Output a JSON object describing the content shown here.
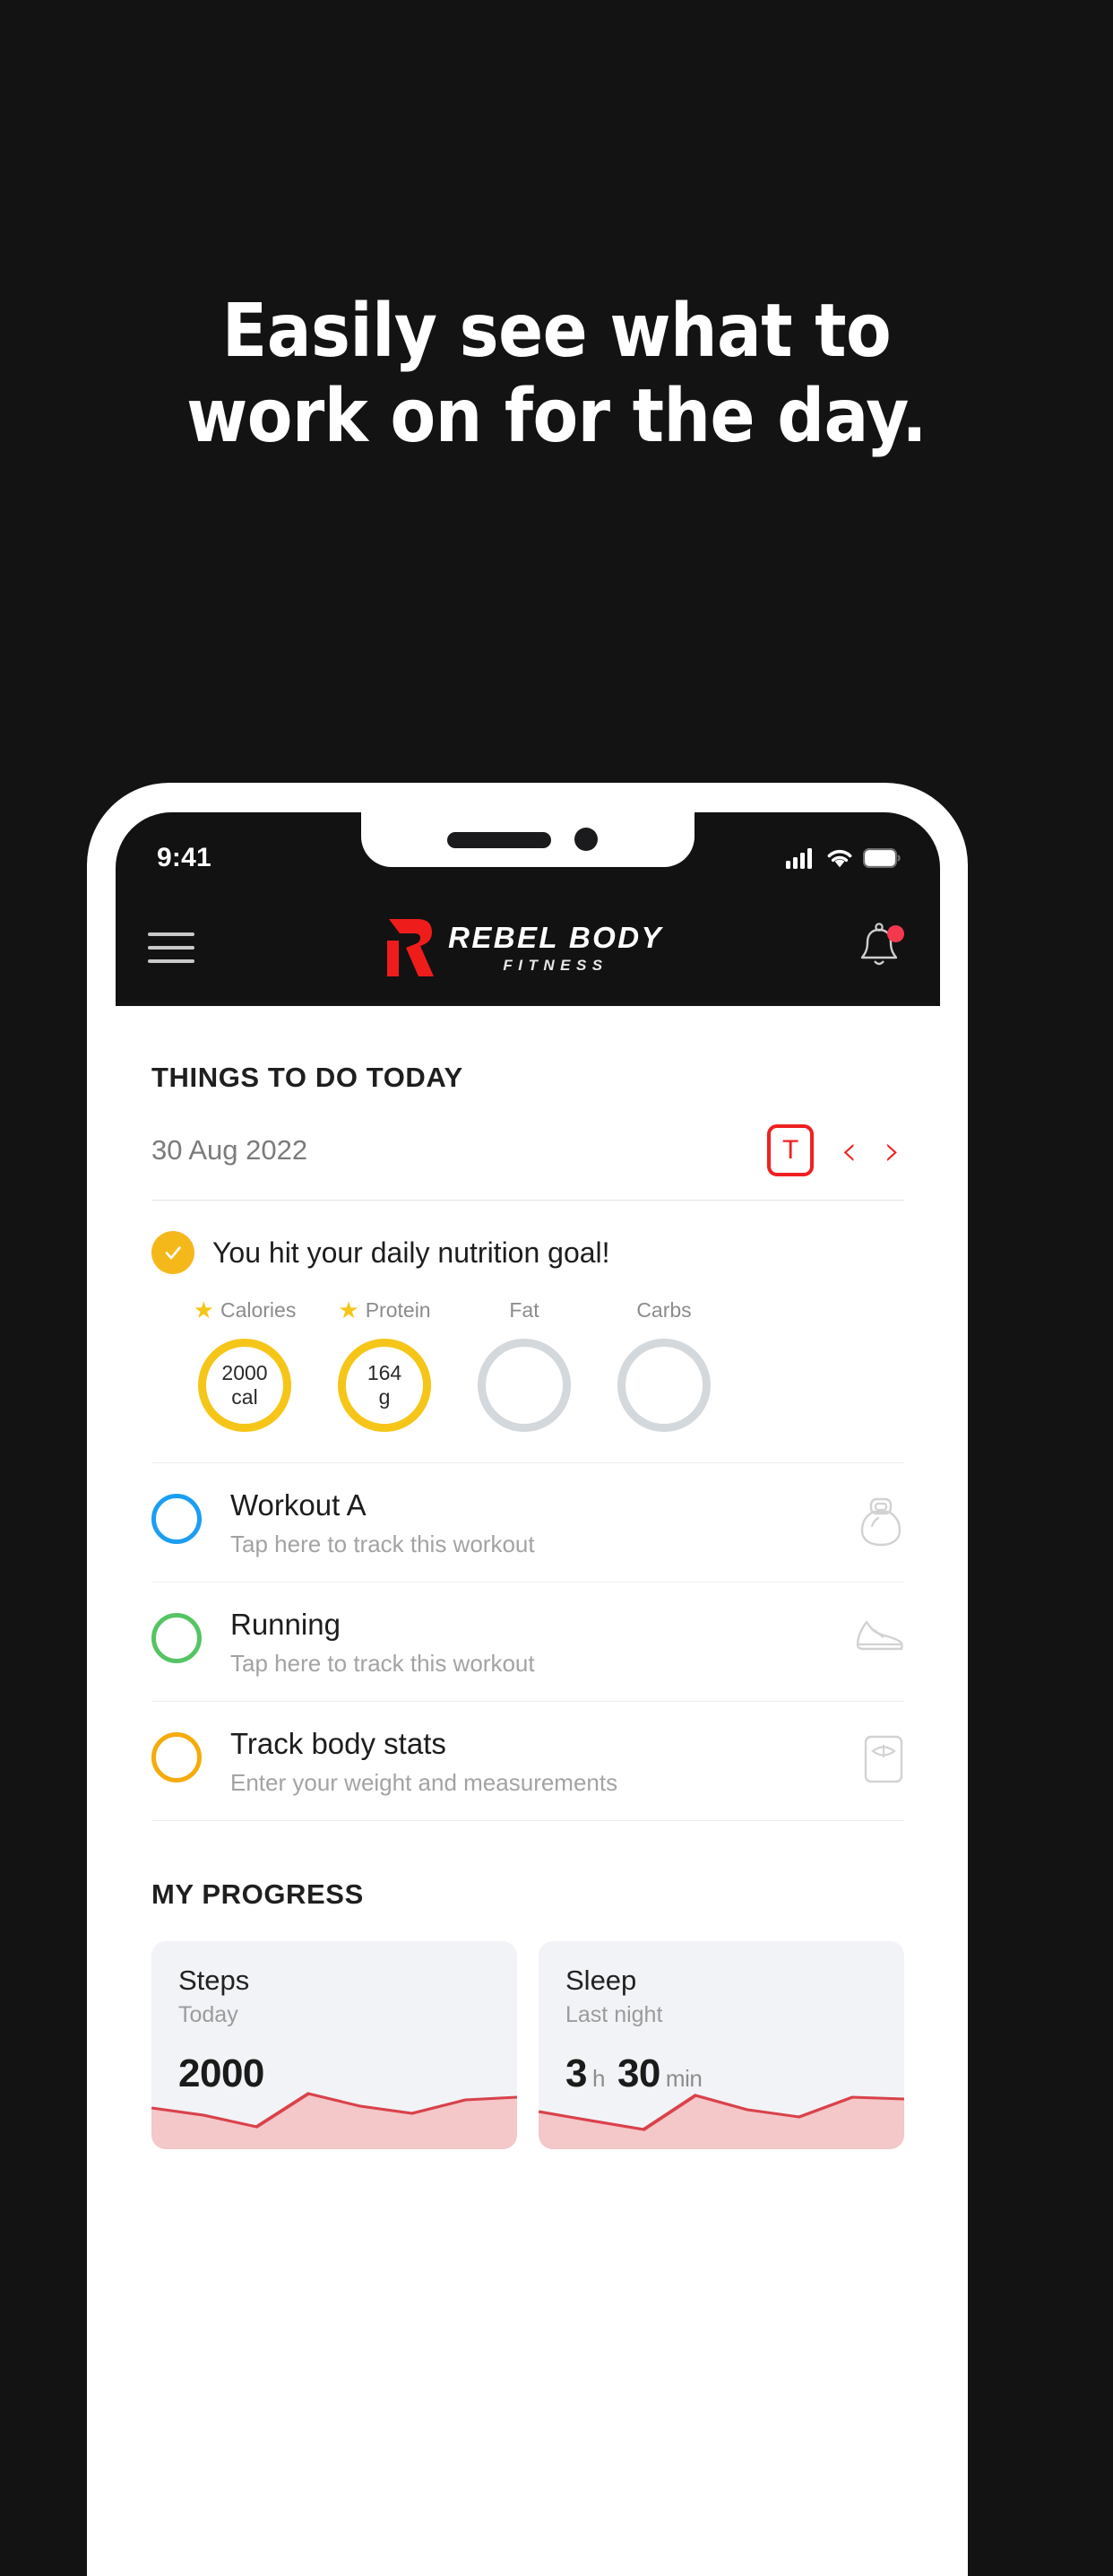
{
  "promo": {
    "headline_line1": "Easily see what to",
    "headline_line2": "work on for the day."
  },
  "statusbar": {
    "time": "9:41",
    "signal_icon": "cellular-signal-icon",
    "wifi_icon": "wifi-icon",
    "battery_icon": "battery-icon"
  },
  "navbar": {
    "menu_icon": "hamburger-menu-icon",
    "brand_main": "REBEL BODY",
    "brand_sub": "FITNESS",
    "logo_icon": "rebel-r-logo-icon",
    "bell_icon": "notification-bell-icon",
    "accent_red": "#f02020"
  },
  "today": {
    "section_title": "THINGS TO DO TODAY",
    "date": "30 Aug 2022",
    "today_button_label": "T",
    "prev_label": "‹",
    "next_label": "›"
  },
  "nutrition": {
    "message": "You hit your daily nutrition goal!",
    "check_icon": "check-circle-icon",
    "gold": "#f5c518",
    "grey": "#d3d8dc",
    "rings": [
      {
        "label": "Calories",
        "starred": true,
        "value": "2000",
        "unit": "cal",
        "filled": true
      },
      {
        "label": "Protein",
        "starred": true,
        "value": "164",
        "unit": "g",
        "filled": true
      },
      {
        "label": "Fat",
        "starred": false,
        "value": "",
        "unit": "",
        "filled": false
      },
      {
        "label": "Carbs",
        "starred": false,
        "value": "",
        "unit": "",
        "filled": false
      }
    ]
  },
  "tasks": [
    {
      "title": "Workout A",
      "subtitle": "Tap here to track this workout",
      "ring_color": "#1b9ef3",
      "icon": "kettlebell-icon"
    },
    {
      "title": "Running",
      "subtitle": "Tap here to track this workout",
      "ring_color": "#55c563",
      "icon": "running-shoe-icon"
    },
    {
      "title": "Track body stats",
      "subtitle": "Enter your weight and measurements",
      "ring_color": "#f5ab0a",
      "icon": "weight-scale-icon"
    }
  ],
  "progress": {
    "section_title": "MY PROGRESS",
    "cards": [
      {
        "title": "Steps",
        "subtitle": "Today",
        "value": "2000",
        "unit1": "",
        "value2": "",
        "unit2": ""
      },
      {
        "title": "Sleep",
        "subtitle": "Last night",
        "value": "3",
        "unit1": "h",
        "value2": "30",
        "unit2": "min"
      }
    ]
  },
  "chart_data": [
    {
      "type": "area",
      "title": "Steps",
      "x": [
        0,
        1,
        2,
        3,
        4,
        5,
        6,
        7
      ],
      "values": [
        46,
        38,
        25,
        62,
        48,
        40,
        55,
        58
      ],
      "ylim": [
        0,
        86
      ],
      "line_color": "#d9424a",
      "fill_color": "#f4c7c9",
      "grid": false,
      "legend": "none"
    },
    {
      "type": "area",
      "title": "Sleep",
      "x": [
        0,
        1,
        2,
        3,
        4,
        5,
        6,
        7
      ],
      "values": [
        42,
        32,
        22,
        60,
        44,
        36,
        58,
        56
      ],
      "ylim": [
        0,
        86
      ],
      "line_color": "#d9424a",
      "fill_color": "#f4c7c9",
      "grid": false,
      "legend": "none"
    }
  ]
}
